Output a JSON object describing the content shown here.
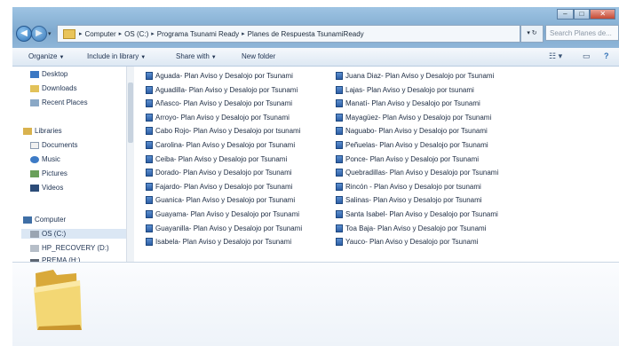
{
  "window": {
    "controls": [
      "–",
      "□",
      "✕"
    ]
  },
  "address": {
    "crumbs": [
      "Computer",
      "OS (C:)",
      "Programa Tsunami Ready",
      "Planes de Respuesta TsunamiReady"
    ],
    "refresh": "▾ ↻",
    "search_placeholder": "Search Planes de..."
  },
  "toolbar": {
    "organize": "Organize",
    "include": "Include in library",
    "share": "Share with",
    "newfolder": "New folder"
  },
  "nav": {
    "favorites": [
      "Desktop",
      "Downloads",
      "Recent Places"
    ],
    "libraries_label": "Libraries",
    "libraries": [
      "Documents",
      "Music",
      "Pictures",
      "Videos"
    ],
    "computer_label": "Computer",
    "drives": [
      "OS (C:)",
      "HP_RECOVERY (D:)",
      "PREMA (H:)"
    ]
  },
  "files": {
    "col1": [
      "Aguada- Plan Aviso y Desalojo por Tsunami",
      "Aguadilla- Plan Aviso y Desalojo por Tsunami",
      "Añasco- Plan Aviso y Desalojo por Tsunami",
      "Arroyo- Plan Aviso y Desalojo por Tsunami",
      "Cabo Rojo- Plan Aviso y Desalojo por tsunami",
      "Carolina- Plan Aviso y Desalojo por Tsunami",
      "Ceiba- Plan Aviso y Desalojo por Tsunami",
      "Dorado- Plan Aviso y Desalojo por Tsunami",
      "Fajardo- Plan Aviso y Desalojo por Tsunami",
      "Guanica- Plan Aviso y Desalojo por Tsunami",
      "Guayama- Plan Aviso y Desalojo por Tsunami",
      "Guayanilla- Plan Aviso y Desalojo por Tsunami",
      "Isabela- Plan Aviso y Desalojo por Tsunami"
    ],
    "col2": [
      "Juana Diaz- Plan Aviso y Desalojo por Tsunami",
      "Lajas- Plan Aviso y Desalojo por tsunami",
      "Manatí- Plan Aviso y Desalojo por Tsunami",
      "Mayagüez- Plan Aviso y Desalojo por Tsunami",
      "Naguabo- Plan Aviso y Desalojo por Tsunami",
      "Peñuelas- Plan Aviso y Desalojo por Tsunami",
      "Ponce- Plan Aviso y Desalojo por Tsunami",
      "Quebradillas- Plan Aviso y Desalojo por Tsunami",
      "Rincón - Plan Aviso y Desalojo por tsunami",
      "Salinas- Plan Aviso y Desalojo por Tsunami",
      "Santa Isabel- Plan Aviso y Desalojo por Tsunami",
      "Toa Baja- Plan Aviso y Desalojo por Tsunami",
      "Yauco- Plan Aviso y Desalojo por Tsunami"
    ]
  }
}
